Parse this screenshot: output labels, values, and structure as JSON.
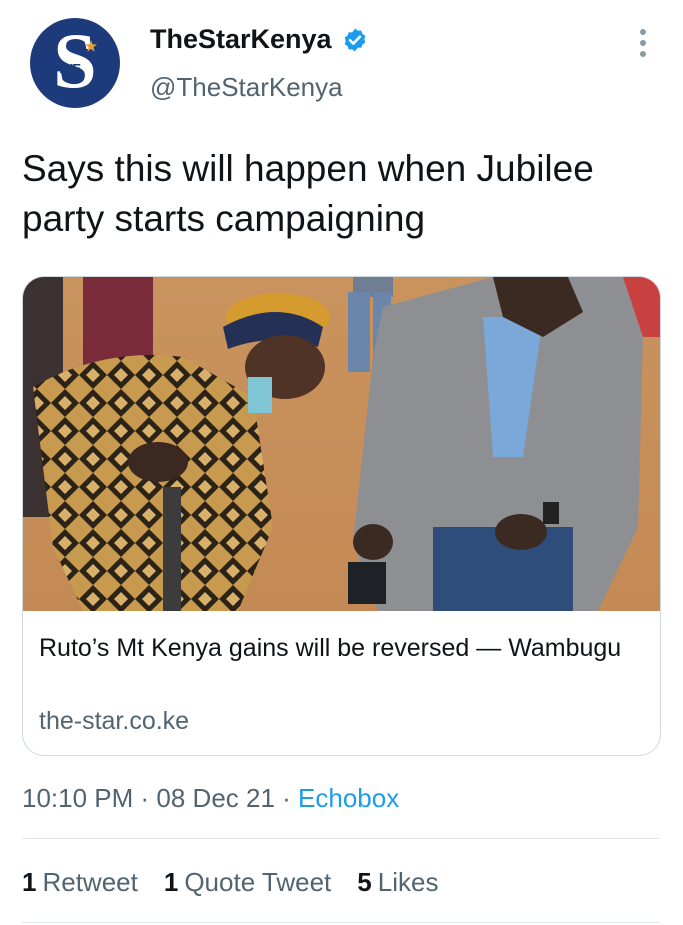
{
  "account": {
    "avatar_icon": "the-star-logo",
    "logo_text": "THE",
    "logo_letter": "S",
    "display_name": "TheStarKenya",
    "handle": "@TheStarKenya",
    "verified_icon": "verified-badge-icon"
  },
  "tweet": {
    "text": "Says this will happen when Jubilee party starts campaigning"
  },
  "card": {
    "title": "Ruto’s Mt Kenya gains will be reversed — Wambugu",
    "domain": "the-star.co.ke"
  },
  "meta": {
    "time": "10:10 PM",
    "separator1": " · ",
    "date": "08 Dec 21",
    "separator2": " · ",
    "source": "Echobox"
  },
  "stats": {
    "retweets_count": "1",
    "retweets_label": "Retweet",
    "quotes_count": "1",
    "quotes_label": "Quote Tweet",
    "likes_count": "5",
    "likes_label": "Likes"
  },
  "colors": {
    "link": "#1d9bf0",
    "secondary_text": "#536471",
    "avatar_bg": "#1d3a7a"
  }
}
